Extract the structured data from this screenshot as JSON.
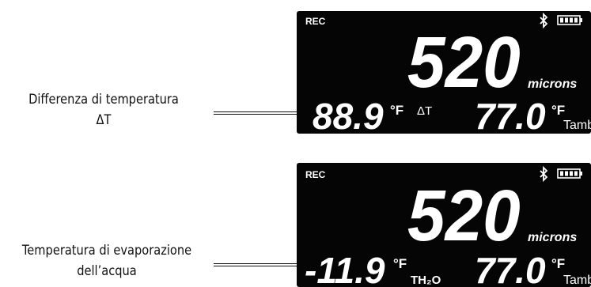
{
  "panels": [
    {
      "label_lines": [
        "Differenza di temperatura",
        "ΔT"
      ],
      "rec": "REC",
      "main_value": "520",
      "main_unit": "microns",
      "left_value": "88.9",
      "left_unit": "°F",
      "left_tag": "ΔT",
      "right_value": "77.0",
      "right_unit": "°F",
      "right_tag": "Tamb"
    },
    {
      "label_lines": [
        "Temperatura di evaporazione",
        "dell’acqua"
      ],
      "rec": "REC",
      "main_value": "520",
      "main_unit": "microns",
      "left_value": "-11.9",
      "left_unit": "°F",
      "left_tag": "TH₂O",
      "right_value": "77.0",
      "right_unit": "°F",
      "right_tag": "Tamb"
    }
  ],
  "icons": [
    "bluetooth-icon",
    "battery-icon"
  ],
  "colors": {
    "lcd_background": "#050505",
    "lcd_segments": "#ffffff"
  }
}
